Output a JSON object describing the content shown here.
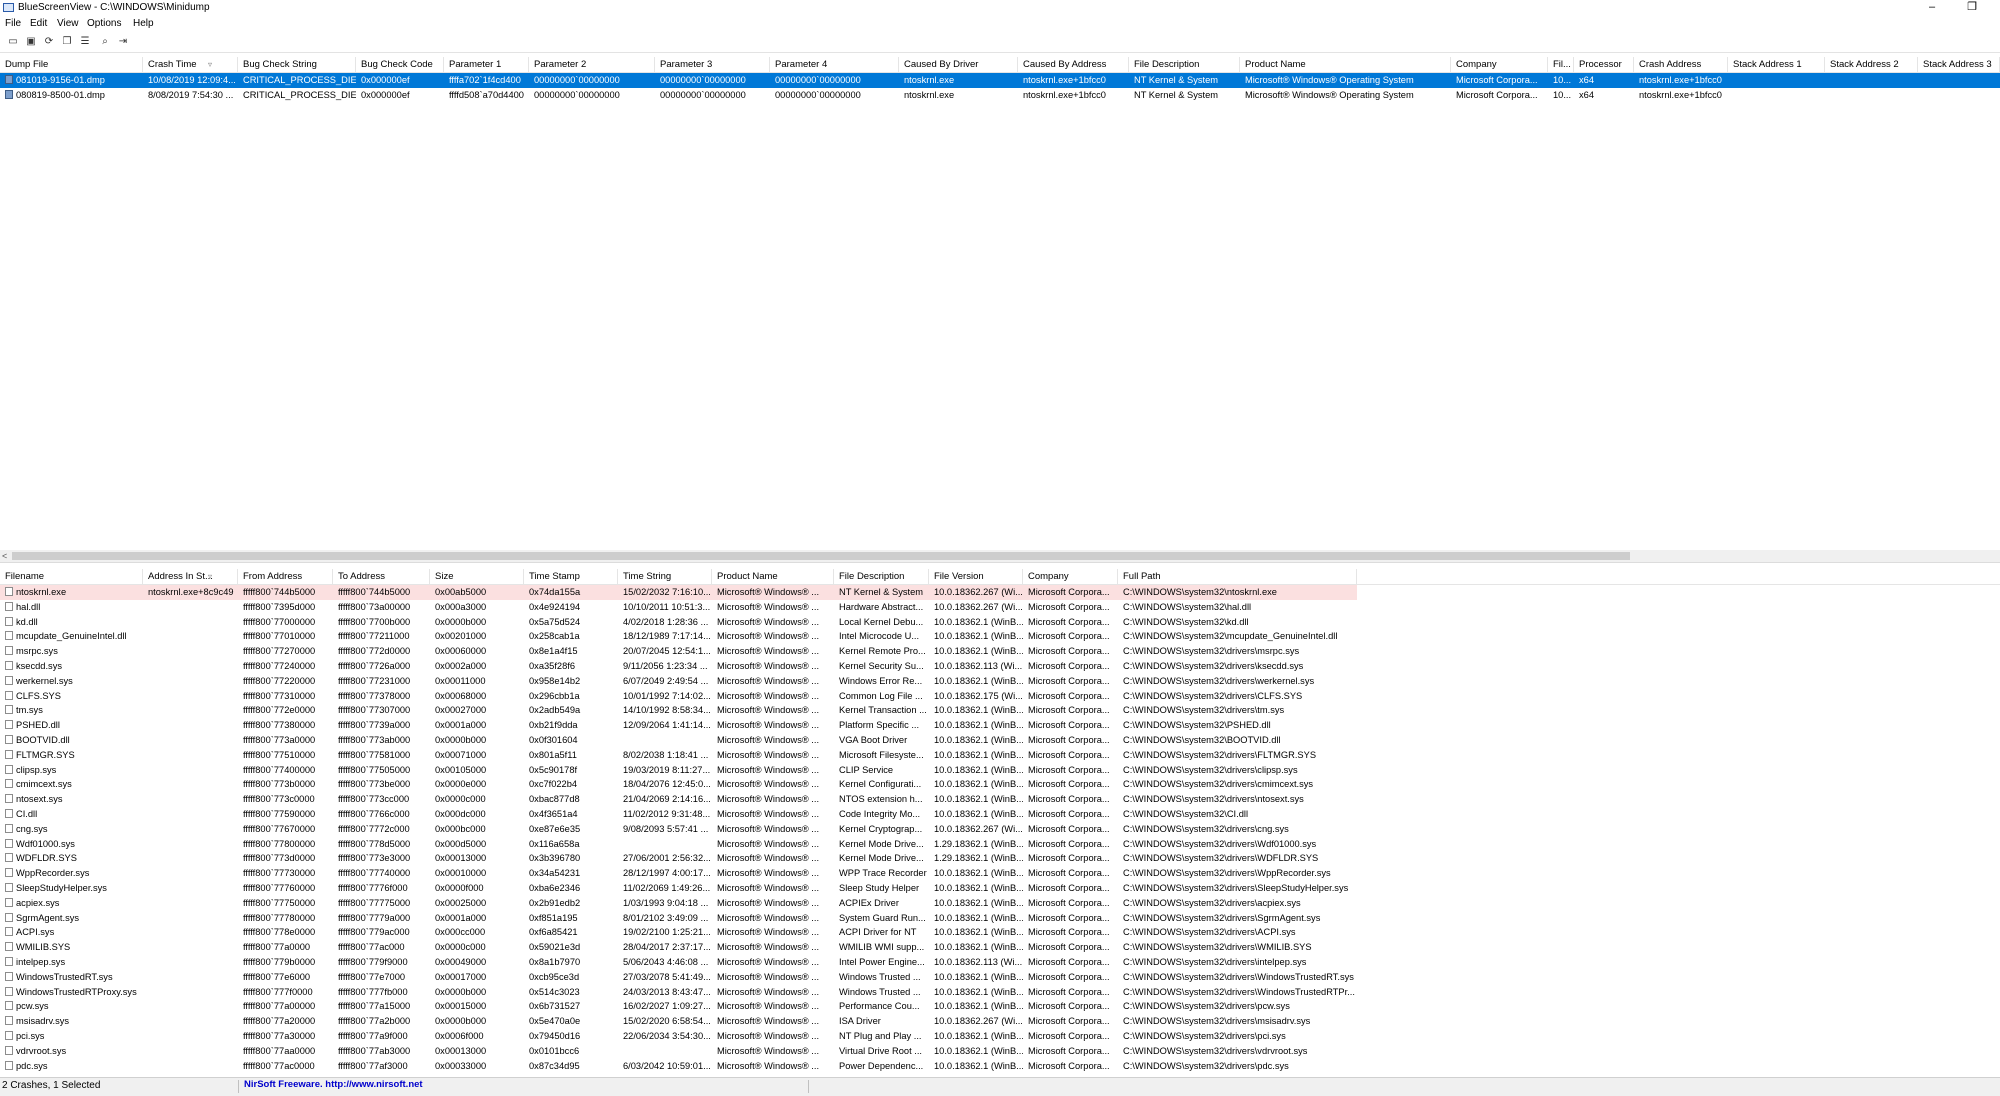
{
  "window": {
    "title": "BlueScreenView  -  C:\\WINDOWS\\Minidump",
    "minimize": "–",
    "restore": "❐"
  },
  "menu": [
    "File",
    "Edit",
    "View",
    "Options",
    "Help"
  ],
  "toolbar": [
    "save-icon",
    "save-all-icon",
    "refresh-icon",
    "copy-icon",
    "properties-icon",
    "find-icon",
    "exit-icon"
  ],
  "top_table": {
    "columns": [
      "Dump File",
      "Crash Time",
      "Bug Check String",
      "Bug Check Code",
      "Parameter 1",
      "Parameter 2",
      "Parameter 3",
      "Parameter 4",
      "Caused By Driver",
      "Caused By Address",
      "File Description",
      "Product Name",
      "Company",
      "Fil...",
      "Processor",
      "Crash Address",
      "Stack Address 1",
      "Stack Address 2",
      "Stack Address 3"
    ],
    "sort_column": "Crash Time",
    "rows": [
      [
        "081019-9156-01.dmp",
        "10/08/2019 12:09:4...",
        "CRITICAL_PROCESS_DIED",
        "0x000000ef",
        "ffffa702`1f4cd400",
        "00000000`00000000",
        "00000000`00000000",
        "00000000`00000000",
        "ntoskrnl.exe",
        "ntoskrnl.exe+1bfcc0",
        "NT Kernel & System",
        "Microsoft® Windows® Operating System",
        "Microsoft Corpora...",
        "10...",
        "x64",
        "ntoskrnl.exe+1bfcc0",
        "",
        "",
        ""
      ],
      [
        "080819-8500-01.dmp",
        "8/08/2019 7:54:30 ...",
        "CRITICAL_PROCESS_DIED",
        "0x000000ef",
        "ffffd508`a70d4400",
        "00000000`00000000",
        "00000000`00000000",
        "00000000`00000000",
        "ntoskrnl.exe",
        "ntoskrnl.exe+1bfcc0",
        "NT Kernel & System",
        "Microsoft® Windows® Operating System",
        "Microsoft Corpora...",
        "10...",
        "x64",
        "ntoskrnl.exe+1bfcc0",
        "",
        "",
        ""
      ]
    ],
    "selected_row": 0
  },
  "bottom_table": {
    "columns": [
      "Filename",
      "Address In St...",
      "From Address",
      "To Address",
      "Size",
      "Time Stamp",
      "Time String",
      "Product Name",
      "File Description",
      "File Version",
      "Company",
      "Full Path"
    ],
    "sort_column": "Address In St...",
    "rows": [
      [
        "ntoskrnl.exe",
        "ntoskrnl.exe+8c9c49",
        "fffff800`744b5000",
        "fffff800`744b5000",
        "0x00ab5000",
        "0x74da155a",
        "15/02/2032 7:16:10...",
        "Microsoft® Windows® ...",
        "NT Kernel & System",
        "10.0.18362.267 (Wi...",
        "Microsoft Corpora...",
        "C:\\WINDOWS\\system32\\ntoskrnl.exe"
      ],
      [
        "hal.dll",
        "",
        "fffff800`7395d000",
        "fffff800`73a00000",
        "0x000a3000",
        "0x4e924194",
        "10/10/2011 10:51:3...",
        "Microsoft® Windows® ...",
        "Hardware Abstract...",
        "10.0.18362.267 (Wi...",
        "Microsoft Corpora...",
        "C:\\WINDOWS\\system32\\hal.dll"
      ],
      [
        "kd.dll",
        "",
        "fffff800`77000000",
        "fffff800`7700b000",
        "0x0000b000",
        "0x5a75d524",
        "4/02/2018 1:28:36 ...",
        "Microsoft® Windows® ...",
        "Local Kernel Debu...",
        "10.0.18362.1 (WinB...",
        "Microsoft Corpora...",
        "C:\\WINDOWS\\system32\\kd.dll"
      ],
      [
        "mcupdate_GenuineIntel.dll",
        "",
        "fffff800`77010000",
        "fffff800`77211000",
        "0x00201000",
        "0x258cab1a",
        "18/12/1989 7:17:14...",
        "Microsoft® Windows® ...",
        "Intel Microcode U...",
        "10.0.18362.1 (WinB...",
        "Microsoft Corpora...",
        "C:\\WINDOWS\\system32\\mcupdate_GenuineIntel.dll"
      ],
      [
        "msrpc.sys",
        "",
        "fffff800`77270000",
        "fffff800`772d0000",
        "0x00060000",
        "0x8e1a4f15",
        "20/07/2045 12:54:1...",
        "Microsoft® Windows® ...",
        "Kernel Remote Pro...",
        "10.0.18362.1 (WinB...",
        "Microsoft Corpora...",
        "C:\\WINDOWS\\system32\\drivers\\msrpc.sys"
      ],
      [
        "ksecdd.sys",
        "",
        "fffff800`77240000",
        "fffff800`7726a000",
        "0x0002a000",
        "0xa35f28f6",
        "9/11/2056 1:23:34 ...",
        "Microsoft® Windows® ...",
        "Kernel Security Su...",
        "10.0.18362.113 (Wi...",
        "Microsoft Corpora...",
        "C:\\WINDOWS\\system32\\drivers\\ksecdd.sys"
      ],
      [
        "werkernel.sys",
        "",
        "fffff800`77220000",
        "fffff800`77231000",
        "0x00011000",
        "0x958e14b2",
        "6/07/2049 2:49:54 ...",
        "Microsoft® Windows® ...",
        "Windows Error Re...",
        "10.0.18362.1 (WinB...",
        "Microsoft Corpora...",
        "C:\\WINDOWS\\system32\\drivers\\werkernel.sys"
      ],
      [
        "CLFS.SYS",
        "",
        "fffff800`77310000",
        "fffff800`77378000",
        "0x00068000",
        "0x296cbb1a",
        "10/01/1992 7:14:02...",
        "Microsoft® Windows® ...",
        "Common Log File ...",
        "10.0.18362.175 (Wi...",
        "Microsoft Corpora...",
        "C:\\WINDOWS\\system32\\drivers\\CLFS.SYS"
      ],
      [
        "tm.sys",
        "",
        "fffff800`772e0000",
        "fffff800`77307000",
        "0x00027000",
        "0x2adb549a",
        "14/10/1992 8:58:34...",
        "Microsoft® Windows® ...",
        "Kernel Transaction ...",
        "10.0.18362.1 (WinB...",
        "Microsoft Corpora...",
        "C:\\WINDOWS\\system32\\drivers\\tm.sys"
      ],
      [
        "PSHED.dll",
        "",
        "fffff800`77380000",
        "fffff800`7739a000",
        "0x0001a000",
        "0xb21f9dda",
        "12/09/2064 1:41:14...",
        "Microsoft® Windows® ...",
        "Platform Specific ...",
        "10.0.18362.1 (WinB...",
        "Microsoft Corpora...",
        "C:\\WINDOWS\\system32\\PSHED.dll"
      ],
      [
        "BOOTVID.dll",
        "",
        "fffff800`773a0000",
        "fffff800`773ab000",
        "0x0000b000",
        "0x0f301604",
        "",
        "Microsoft® Windows® ...",
        "VGA Boot Driver",
        "10.0.18362.1 (WinB...",
        "Microsoft Corpora...",
        "C:\\WINDOWS\\system32\\BOOTVID.dll"
      ],
      [
        "FLTMGR.SYS",
        "",
        "fffff800`77510000",
        "fffff800`77581000",
        "0x00071000",
        "0x801a5f11",
        "8/02/2038 1:18:41 ...",
        "Microsoft® Windows® ...",
        "Microsoft Filesyste...",
        "10.0.18362.1 (WinB...",
        "Microsoft Corpora...",
        "C:\\WINDOWS\\system32\\drivers\\FLTMGR.SYS"
      ],
      [
        "clipsp.sys",
        "",
        "fffff800`77400000",
        "fffff800`77505000",
        "0x00105000",
        "0x5c90178f",
        "19/03/2019 8:11:27...",
        "Microsoft® Windows® ...",
        "CLIP Service",
        "10.0.18362.1 (WinB...",
        "Microsoft Corpora...",
        "C:\\WINDOWS\\system32\\drivers\\clipsp.sys"
      ],
      [
        "cmimcext.sys",
        "",
        "fffff800`773b0000",
        "fffff800`773be000",
        "0x0000e000",
        "0xc7f022b4",
        "18/04/2076 12:45:0...",
        "Microsoft® Windows® ...",
        "Kernel Configurati...",
        "10.0.18362.1 (WinB...",
        "Microsoft Corpora...",
        "C:\\WINDOWS\\system32\\drivers\\cmimcext.sys"
      ],
      [
        "ntosext.sys",
        "",
        "fffff800`773c0000",
        "fffff800`773cc000",
        "0x0000c000",
        "0xbac877d8",
        "21/04/2069 2:14:16...",
        "Microsoft® Windows® ...",
        "NTOS extension h...",
        "10.0.18362.1 (WinB...",
        "Microsoft Corpora...",
        "C:\\WINDOWS\\system32\\drivers\\ntosext.sys"
      ],
      [
        "CI.dll",
        "",
        "fffff800`77590000",
        "fffff800`7766c000",
        "0x000dc000",
        "0x4f3651a4",
        "11/02/2012 9:31:48...",
        "Microsoft® Windows® ...",
        "Code Integrity Mo...",
        "10.0.18362.1 (WinB...",
        "Microsoft Corpora...",
        "C:\\WINDOWS\\system32\\CI.dll"
      ],
      [
        "cng.sys",
        "",
        "fffff800`77670000",
        "fffff800`7772c000",
        "0x000bc000",
        "0xe87e6e35",
        "9/08/2093 5:57:41 ...",
        "Microsoft® Windows® ...",
        "Kernel Cryptograp...",
        "10.0.18362.267 (Wi...",
        "Microsoft Corpora...",
        "C:\\WINDOWS\\system32\\drivers\\cng.sys"
      ],
      [
        "Wdf01000.sys",
        "",
        "fffff800`77800000",
        "fffff800`778d5000",
        "0x000d5000",
        "0x116a658a",
        "",
        "Microsoft® Windows® ...",
        "Kernel Mode Drive...",
        "1.29.18362.1 (WinB...",
        "Microsoft Corpora...",
        "C:\\WINDOWS\\system32\\drivers\\Wdf01000.sys"
      ],
      [
        "WDFLDR.SYS",
        "",
        "fffff800`773d0000",
        "fffff800`773e3000",
        "0x00013000",
        "0x3b396780",
        "27/06/2001 2:56:32...",
        "Microsoft® Windows® ...",
        "Kernel Mode Drive...",
        "1.29.18362.1 (WinB...",
        "Microsoft Corpora...",
        "C:\\WINDOWS\\system32\\drivers\\WDFLDR.SYS"
      ],
      [
        "WppRecorder.sys",
        "",
        "fffff800`77730000",
        "fffff800`77740000",
        "0x00010000",
        "0x34a54231",
        "28/12/1997 4:00:17...",
        "Microsoft® Windows® ...",
        "WPP Trace Recorder",
        "10.0.18362.1 (WinB...",
        "Microsoft Corpora...",
        "C:\\WINDOWS\\system32\\drivers\\WppRecorder.sys"
      ],
      [
        "SleepStudyHelper.sys",
        "",
        "fffff800`77760000",
        "fffff800`7776f000",
        "0x0000f000",
        "0xba6e2346",
        "11/02/2069 1:49:26...",
        "Microsoft® Windows® ...",
        "Sleep Study Helper",
        "10.0.18362.1 (WinB...",
        "Microsoft Corpora...",
        "C:\\WINDOWS\\system32\\drivers\\SleepStudyHelper.sys"
      ],
      [
        "acpiex.sys",
        "",
        "fffff800`77750000",
        "fffff800`77775000",
        "0x00025000",
        "0x2b91edb2",
        "1/03/1993 9:04:18 ...",
        "Microsoft® Windows® ...",
        "ACPIEx Driver",
        "10.0.18362.1 (WinB...",
        "Microsoft Corpora...",
        "C:\\WINDOWS\\system32\\drivers\\acpiex.sys"
      ],
      [
        "SgrmAgent.sys",
        "",
        "fffff800`77780000",
        "fffff800`7779a000",
        "0x0001a000",
        "0xf851a195",
        "8/01/2102 3:49:09 ...",
        "Microsoft® Windows® ...",
        "System Guard Run...",
        "10.0.18362.1 (WinB...",
        "Microsoft Corpora...",
        "C:\\WINDOWS\\system32\\drivers\\SgrmAgent.sys"
      ],
      [
        "ACPI.sys",
        "",
        "fffff800`778e0000",
        "fffff800`779ac000",
        "0x000cc000",
        "0xf6a85421",
        "19/02/2100 1:25:21...",
        "Microsoft® Windows® ...",
        "ACPI Driver for NT",
        "10.0.18362.1 (WinB...",
        "Microsoft Corpora...",
        "C:\\WINDOWS\\system32\\drivers\\ACPI.sys"
      ],
      [
        "WMILIB.SYS",
        "",
        "fffff800`77a0000",
        "fffff800`77ac000",
        "0x0000c000",
        "0x59021e3d",
        "28/04/2017 2:37:17...",
        "Microsoft® Windows® ...",
        "WMILIB WMI supp...",
        "10.0.18362.1 (WinB...",
        "Microsoft Corpora...",
        "C:\\WINDOWS\\system32\\drivers\\WMILIB.SYS"
      ],
      [
        "intelpep.sys",
        "",
        "fffff800`779b0000",
        "fffff800`779f9000",
        "0x00049000",
        "0x8a1b7970",
        "5/06/2043 4:46:08 ...",
        "Microsoft® Windows® ...",
        "Intel Power Engine...",
        "10.0.18362.113 (Wi...",
        "Microsoft Corpora...",
        "C:\\WINDOWS\\system32\\drivers\\intelpep.sys"
      ],
      [
        "WindowsTrustedRT.sys",
        "",
        "fffff800`77e6000",
        "fffff800`77e7000",
        "0x00017000",
        "0xcb95ce3d",
        "27/03/2078 5:41:49...",
        "Microsoft® Windows® ...",
        "Windows Trusted ...",
        "10.0.18362.1 (WinB...",
        "Microsoft Corpora...",
        "C:\\WINDOWS\\system32\\drivers\\WindowsTrustedRT.sys"
      ],
      [
        "WindowsTrustedRTProxy.sys",
        "",
        "fffff800`777f0000",
        "fffff800`777fb000",
        "0x0000b000",
        "0x514c3023",
        "24/03/2013 8:43:47...",
        "Microsoft® Windows® ...",
        "Windows Trusted ...",
        "10.0.18362.1 (WinB...",
        "Microsoft Corpora...",
        "C:\\WINDOWS\\system32\\drivers\\WindowsTrustedRTPr..."
      ],
      [
        "pcw.sys",
        "",
        "fffff800`77a00000",
        "fffff800`77a15000",
        "0x00015000",
        "0x6b731527",
        "16/02/2027 1:09:27...",
        "Microsoft® Windows® ...",
        "Performance Cou...",
        "10.0.18362.1 (WinB...",
        "Microsoft Corpora...",
        "C:\\WINDOWS\\system32\\drivers\\pcw.sys"
      ],
      [
        "msisadrv.sys",
        "",
        "fffff800`77a20000",
        "fffff800`77a2b000",
        "0x0000b000",
        "0x5e470a0e",
        "15/02/2020 6:58:54...",
        "Microsoft® Windows® ...",
        "ISA Driver",
        "10.0.18362.267 (Wi...",
        "Microsoft Corpora...",
        "C:\\WINDOWS\\system32\\drivers\\msisadrv.sys"
      ],
      [
        "pci.sys",
        "",
        "fffff800`77a30000",
        "fffff800`77a9f000",
        "0x0006f000",
        "0x79450d16",
        "22/06/2034 3:54:30...",
        "Microsoft® Windows® ...",
        "NT Plug and Play ...",
        "10.0.18362.1 (WinB...",
        "Microsoft Corpora...",
        "C:\\WINDOWS\\system32\\drivers\\pci.sys"
      ],
      [
        "vdrvroot.sys",
        "",
        "fffff800`77aa0000",
        "fffff800`77ab3000",
        "0x00013000",
        "0x0101bcc6",
        "",
        "Microsoft® Windows® ...",
        "Virtual Drive Root ...",
        "10.0.18362.1 (WinB...",
        "Microsoft Corpora...",
        "C:\\WINDOWS\\system32\\drivers\\vdrvroot.sys"
      ],
      [
        "pdc.sys",
        "",
        "fffff800`77ac0000",
        "fffff800`77af3000",
        "0x00033000",
        "0x87c34d95",
        "6/03/2042 10:59:01...",
        "Microsoft® Windows® ...",
        "Power Dependenc...",
        "10.0.18362.1 (WinB...",
        "Microsoft Corpora...",
        "C:\\WINDOWS\\system32\\drivers\\pdc.sys"
      ]
    ],
    "highlighted_row": 0
  },
  "status": {
    "count_text": "2 Crashes, 1 Selected",
    "credit_text": "NirSoft Freeware.  http://www.nirsoft.net"
  },
  "colors": {
    "selection": "#0078d7",
    "highlight": "#fbe0e0",
    "link": "#0000cc"
  }
}
